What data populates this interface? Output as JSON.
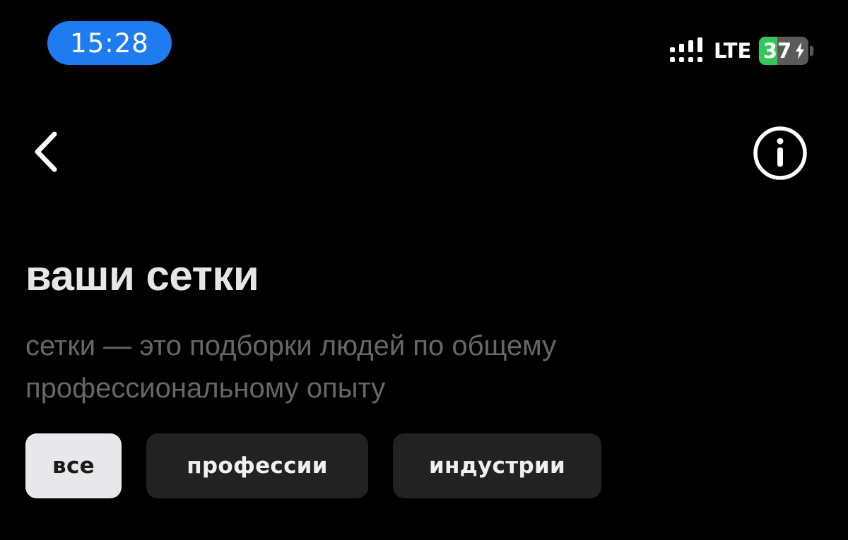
{
  "status_bar": {
    "time": "15:28",
    "network": "LTE",
    "battery_percent": "37",
    "battery_level": 0.37,
    "battery_charging": true
  },
  "header": {
    "back_icon": "chevron-left-icon",
    "info_icon": "info-circle-icon"
  },
  "main": {
    "title": "ваши сетки",
    "description": "сетки — это подборки людей по общему профессиональному опыту"
  },
  "filters": [
    {
      "label": "все",
      "active": true
    },
    {
      "label": "профессии",
      "active": false
    },
    {
      "label": "индустрии",
      "active": false
    }
  ],
  "colors": {
    "background": "#000000",
    "time_pill": "#1f7cf0",
    "battery_fill": "#35c759",
    "chip_active_bg": "#e8e8ea",
    "chip_bg": "#222222"
  }
}
